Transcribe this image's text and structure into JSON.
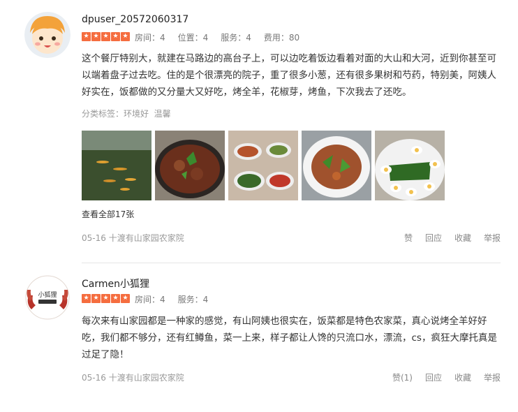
{
  "colors": {
    "star": "#f56d3f",
    "text": "#333333",
    "muted": "#999999"
  },
  "reviews": [
    {
      "username": "dpuser_20572060317",
      "avatar_icon": "cartoon-face-avatar",
      "rating_stars": 5,
      "scores": [
        "房间：4",
        "位置：4",
        "服务：4",
        "费用：80"
      ],
      "content": "这个餐厅特别大，就建在马路边的高台子上，可以边吃着饭边看着对面的大山和大河，近到你甚至可以端着盘子过去吃。住的是个很漂亮的院子，重了很多小葱，还有很多果树和芍药，特别美，阿姨人好实在，饭都做的又分量大又好吃，烤全羊，花椒芽，烤鱼，下次我去了还吃。",
      "tags_label": "分类标签：",
      "tags": [
        "环境好",
        "温馨"
      ],
      "view_all": "查看全部17张",
      "date": "05-16",
      "place": "十渡有山家园农家院",
      "actions": [
        "赞",
        "回应",
        "收藏",
        "举报"
      ]
    },
    {
      "username": "Carmen小狐狸",
      "avatar_icon": "logo-avatar",
      "avatar_logo_text": "小狐狸",
      "rating_stars": 5,
      "scores": [
        "房间：4",
        "服务：4"
      ],
      "content": "每次来有山家园都是一种家的感觉，有山阿姨也很实在，饭菜都是特色农家菜，真心说烤全羊好好吃，我们都不够分，还有红鳟鱼，菜一上来，样子都让人馋的只流口水，漂流，cs，疯狂大摩托真是过足了隐！",
      "date": "05-16",
      "place": "十渡有山家园农家院",
      "actions": [
        "赞(1)",
        "回应",
        "收藏",
        "举报"
      ]
    }
  ]
}
